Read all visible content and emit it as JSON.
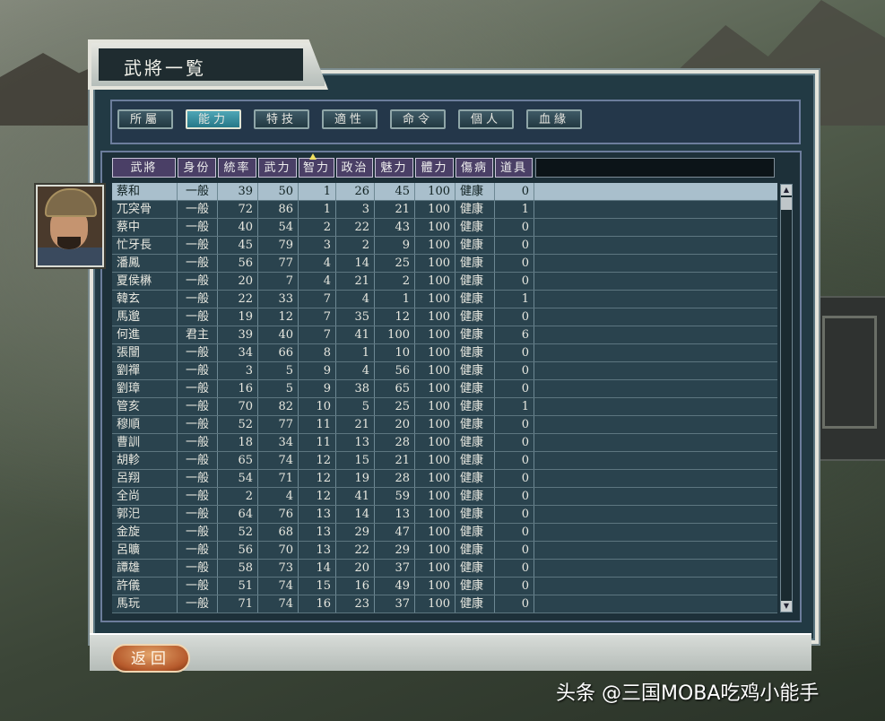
{
  "window": {
    "title": "武將一覧"
  },
  "tabs": [
    {
      "label": "所屬"
    },
    {
      "label": "能力"
    },
    {
      "label": "特技"
    },
    {
      "label": "適性"
    },
    {
      "label": "命令"
    },
    {
      "label": "個人"
    },
    {
      "label": "血緣"
    }
  ],
  "active_tab": "能力",
  "table": {
    "headers": [
      "武將",
      "身份",
      "統率",
      "武力",
      "智力",
      "政治",
      "魅力",
      "體力",
      "傷病",
      "道具"
    ],
    "sort_column": "智力",
    "rows": [
      [
        "蔡和",
        "一般",
        "39",
        "50",
        "1",
        "26",
        "45",
        "100",
        "健康",
        "0"
      ],
      [
        "兀突骨",
        "一般",
        "72",
        "86",
        "1",
        "3",
        "21",
        "100",
        "健康",
        "1"
      ],
      [
        "蔡中",
        "一般",
        "40",
        "54",
        "2",
        "22",
        "43",
        "100",
        "健康",
        "0"
      ],
      [
        "忙牙長",
        "一般",
        "45",
        "79",
        "3",
        "2",
        "9",
        "100",
        "健康",
        "0"
      ],
      [
        "潘鳳",
        "一般",
        "56",
        "77",
        "4",
        "14",
        "25",
        "100",
        "健康",
        "0"
      ],
      [
        "夏侯楙",
        "一般",
        "20",
        "7",
        "4",
        "21",
        "2",
        "100",
        "健康",
        "0"
      ],
      [
        "韓玄",
        "一般",
        "22",
        "33",
        "7",
        "4",
        "1",
        "100",
        "健康",
        "1"
      ],
      [
        "馬邈",
        "一般",
        "19",
        "12",
        "7",
        "35",
        "12",
        "100",
        "健康",
        "0"
      ],
      [
        "何進",
        "君主",
        "39",
        "40",
        "7",
        "41",
        "100",
        "100",
        "健康",
        "6"
      ],
      [
        "張闓",
        "一般",
        "34",
        "66",
        "8",
        "1",
        "10",
        "100",
        "健康",
        "0"
      ],
      [
        "劉禪",
        "一般",
        "3",
        "5",
        "9",
        "4",
        "56",
        "100",
        "健康",
        "0"
      ],
      [
        "劉璋",
        "一般",
        "16",
        "5",
        "9",
        "38",
        "65",
        "100",
        "健康",
        "0"
      ],
      [
        "管亥",
        "一般",
        "70",
        "82",
        "10",
        "5",
        "25",
        "100",
        "健康",
        "1"
      ],
      [
        "穆順",
        "一般",
        "52",
        "77",
        "11",
        "21",
        "20",
        "100",
        "健康",
        "0"
      ],
      [
        "曹訓",
        "一般",
        "18",
        "34",
        "11",
        "13",
        "28",
        "100",
        "健康",
        "0"
      ],
      [
        "胡軫",
        "一般",
        "65",
        "74",
        "12",
        "15",
        "21",
        "100",
        "健康",
        "0"
      ],
      [
        "呂翔",
        "一般",
        "54",
        "71",
        "12",
        "19",
        "28",
        "100",
        "健康",
        "0"
      ],
      [
        "全尚",
        "一般",
        "2",
        "4",
        "12",
        "41",
        "59",
        "100",
        "健康",
        "0"
      ],
      [
        "郭汜",
        "一般",
        "64",
        "76",
        "13",
        "14",
        "13",
        "100",
        "健康",
        "0"
      ],
      [
        "金旋",
        "一般",
        "52",
        "68",
        "13",
        "29",
        "47",
        "100",
        "健康",
        "0"
      ],
      [
        "呂曠",
        "一般",
        "56",
        "70",
        "13",
        "22",
        "29",
        "100",
        "健康",
        "0"
      ],
      [
        "譚雄",
        "一般",
        "58",
        "73",
        "14",
        "20",
        "37",
        "100",
        "健康",
        "0"
      ],
      [
        "許儀",
        "一般",
        "51",
        "74",
        "15",
        "16",
        "49",
        "100",
        "健康",
        "0"
      ],
      [
        "馬玩",
        "一般",
        "71",
        "74",
        "16",
        "23",
        "37",
        "100",
        "健康",
        "0"
      ]
    ]
  },
  "back_button": {
    "label": "返回"
  },
  "watermark": "头条 @三国MOBA吃鸡小能手",
  "colors": {
    "header_bg": "#4a3f66",
    "active_tab": "#4fa6b6",
    "selected_row": "#a9bfcc",
    "panel": "#223a44"
  }
}
